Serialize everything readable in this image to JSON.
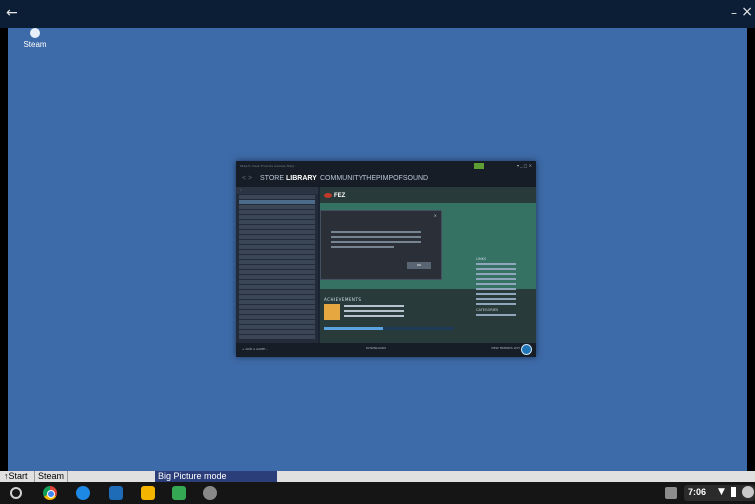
{
  "app_bar": {
    "back_glyph": "←",
    "minimize_glyph": "–",
    "close_glyph": "×"
  },
  "desktop": {
    "background": "#3d6aa8",
    "icons": [
      {
        "label": "Steam",
        "icon": "steam-icon"
      }
    ]
  },
  "steam_window": {
    "nav": {
      "arrows": "< >",
      "store": "STORE",
      "library": "LIBRARY",
      "community": "COMMUNITY",
      "profile": "THEPIMPOFSOUND"
    },
    "selected_game": "FEZ",
    "dialog_ok": "OK",
    "achievements_heading": "ACHIEVEMENTS",
    "achievements_progress": 0.45,
    "links_heading": "LINKS",
    "categories_heading": "CATEGORIES",
    "add_game": "+ ADD A GAME...",
    "downloads": "DOWNLOADS",
    "friends": "VIEW FRIENDS LIST"
  },
  "windows_taskbar": {
    "start": "Start",
    "items": [
      "Steam",
      "Big Picture mode"
    ]
  },
  "shelf": {
    "time": "7:06",
    "apps": [
      "chrome-icon",
      "files-icon",
      "remote-desktop-icon",
      "keep-icon",
      "play-store-icon",
      "photos-icon"
    ]
  }
}
